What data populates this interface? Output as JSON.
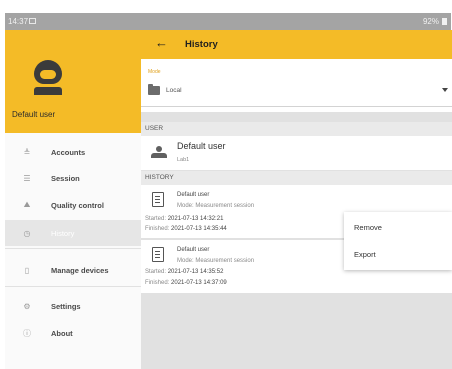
{
  "status_bar": {
    "time": "14:37",
    "battery": "92%"
  },
  "drawer": {
    "user_name": "Default user",
    "items": [
      {
        "label": "Accounts",
        "icon": "accounts-icon",
        "glyph": "≜"
      },
      {
        "label": "Session",
        "icon": "session-icon",
        "glyph": "☰"
      },
      {
        "label": "Quality control",
        "icon": "quality-control-icon",
        "glyph": "⛰"
      },
      {
        "label": "History",
        "icon": "history-icon",
        "glyph": "◷",
        "active": true
      },
      {
        "label": "Manage devices",
        "icon": "devices-icon",
        "glyph": "▯"
      },
      {
        "label": "Settings",
        "icon": "settings-icon",
        "glyph": "⚙"
      },
      {
        "label": "About",
        "icon": "info-icon",
        "glyph": "ⓘ"
      }
    ]
  },
  "app_bar": {
    "title": "History"
  },
  "mode_field": {
    "label": "Mode",
    "value": "Local"
  },
  "sections": {
    "user": "USER",
    "history": "HISTORY"
  },
  "user_card": {
    "name": "Default user",
    "location": "Lab1"
  },
  "history": [
    {
      "user": "Default user",
      "mode": "Mode: Measurement session",
      "started_label": "Started:",
      "started": "2021-07-13 14:32:21",
      "finished_label": "Finished:",
      "finished": "2021-07-13 14:35:44"
    },
    {
      "user": "Default user",
      "mode": "Mode: Measurement session",
      "started_label": "Started:",
      "started": "2021-07-13 14:35:52",
      "finished_label": "Finished:",
      "finished": "2021-07-13 14:37:09"
    }
  ],
  "popup_menu": {
    "items": [
      "Remove",
      "Export"
    ]
  },
  "colors": {
    "accent": "#f4bb27",
    "status_bar": "#a4a4a4",
    "content_bg": "#e1e1e1"
  }
}
